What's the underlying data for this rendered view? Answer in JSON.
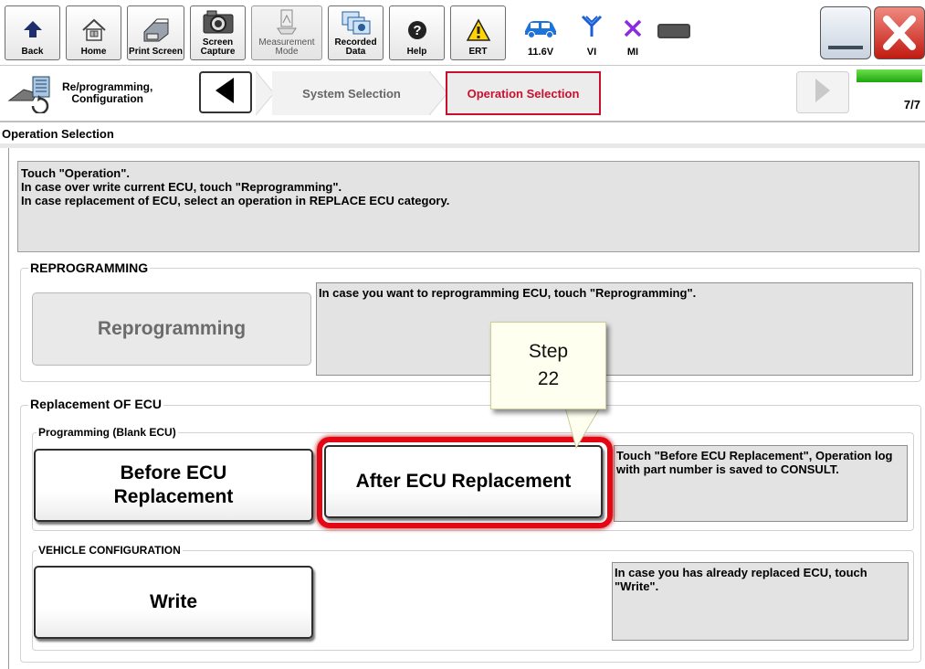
{
  "toolbar": {
    "buttons": [
      {
        "label": "Back",
        "icon": "back-arrow-icon"
      },
      {
        "label": "Home",
        "icon": "home-icon"
      },
      {
        "label": "Print Screen",
        "icon": "printer-icon"
      },
      {
        "label": "Screen\nCapture",
        "icon": "camera-icon"
      },
      {
        "label": "Measurement\nMode",
        "icon": "measurement-icon"
      },
      {
        "label": "Recorded\nData",
        "icon": "recorded-data-icon"
      },
      {
        "label": "Help",
        "icon": "help-icon"
      },
      {
        "label": "ERT",
        "icon": "warning-icon"
      }
    ],
    "battery_voltage": "11.6V",
    "vi_label": "VI",
    "mi_label": "MI",
    "colors": {
      "accent_blue": "#1e73d8",
      "vi_blue": "#1a5fd6",
      "mi_purple": "#8a2be2",
      "close_red": "#d9231a"
    }
  },
  "nav": {
    "section_title": "Re/programming,\nConfiguration",
    "steps": [
      "System Selection",
      "Operation Selection"
    ],
    "active_step": "Operation Selection",
    "progress": "7/7",
    "progress_fraction": 1.0,
    "active_color": "#c8102e"
  },
  "page": {
    "title": "Operation Selection",
    "instructions": [
      "Touch \"Operation\".",
      "In case over write current ECU, touch \"Reprogramming\".",
      "In case replacement of ECU, select an operation in REPLACE ECU category."
    ]
  },
  "reprogramming": {
    "group_title": "REPROGRAMMING",
    "button_label": "Reprogramming",
    "description": "In case you want to reprogramming ECU, touch \"Reprogramming\"."
  },
  "replacement": {
    "group_title": "Replacement OF ECU",
    "programming_title": "Programming (Blank ECU)",
    "before_label": "Before ECU\nReplacement",
    "after_label": "After ECU Replacement",
    "programming_description": "Touch \"Before ECU Replacement\", Operation log with part number is saved to CONSULT.",
    "vehicle_config_title": "VEHICLE CONFIGURATION",
    "write_label": "Write",
    "write_description": "In case you has already replaced ECU, touch \"Write\"."
  },
  "callout": {
    "text": "Step\n22",
    "highlight_color": "#e30613"
  }
}
